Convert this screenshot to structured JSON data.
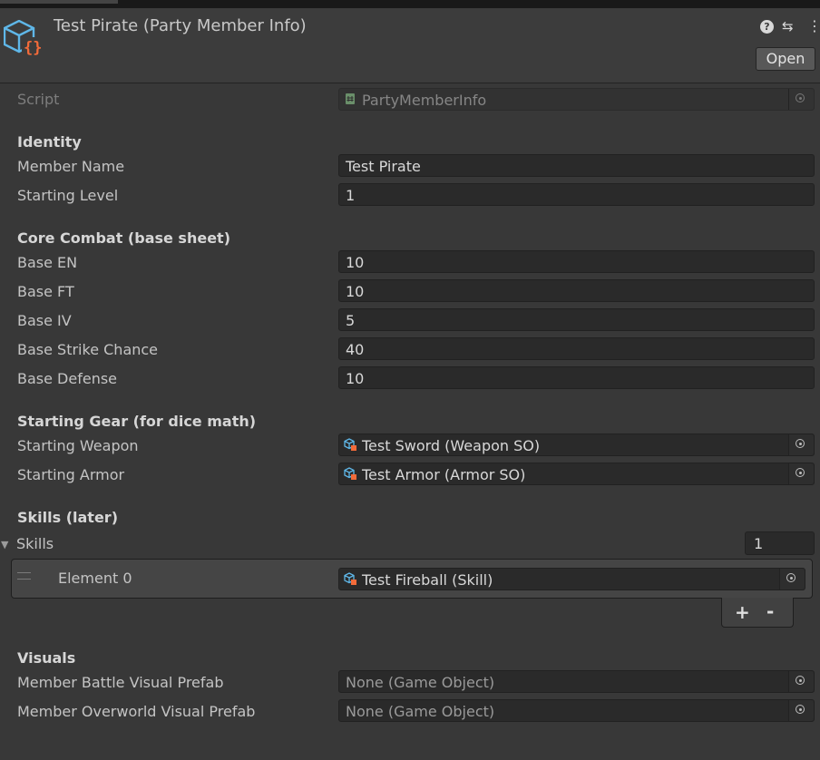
{
  "header": {
    "title": "Test Pirate (Party Member Info)",
    "open_label": "Open",
    "icons": [
      "scriptable-object-icon",
      "help-icon",
      "preset-icon",
      "kebab-menu-icon"
    ]
  },
  "script": {
    "label": "Script",
    "value": "PartyMemberInfo"
  },
  "identity": {
    "title": "Identity",
    "member_name_label": "Member Name",
    "member_name": "Test Pirate",
    "starting_level_label": "Starting Level",
    "starting_level": "1"
  },
  "combat": {
    "title": "Core Combat (base sheet)",
    "en_label": "Base EN",
    "en": "10",
    "ft_label": "Base FT",
    "ft": "10",
    "iv_label": "Base IV",
    "iv": "5",
    "strike_label": "Base Strike Chance",
    "strike": "40",
    "defense_label": "Base Defense",
    "defense": "10"
  },
  "gear": {
    "title": "Starting Gear (for dice math)",
    "weapon_label": "Starting Weapon",
    "weapon": "Test Sword (Weapon SO)",
    "armor_label": "Starting Armor",
    "armor": "Test Armor (Armor SO)"
  },
  "skills": {
    "title": "Skills (later)",
    "list_label": "Skills",
    "count": "1",
    "element_label": "Element 0",
    "element_value": "Test Fireball (Skill)",
    "add_label": "+",
    "remove_label": "-"
  },
  "visuals": {
    "title": "Visuals",
    "battle_label": "Member Battle Visual Prefab",
    "battle": "None (Game Object)",
    "overworld_label": "Member Overworld Visual Prefab",
    "overworld": "None (Game Object)"
  },
  "colors": {
    "background": "#383838",
    "field": "#2a2a2a",
    "text": "#d2d2d2",
    "icon_blue": "#5fb7e8",
    "icon_orange": "#f26b3a"
  }
}
